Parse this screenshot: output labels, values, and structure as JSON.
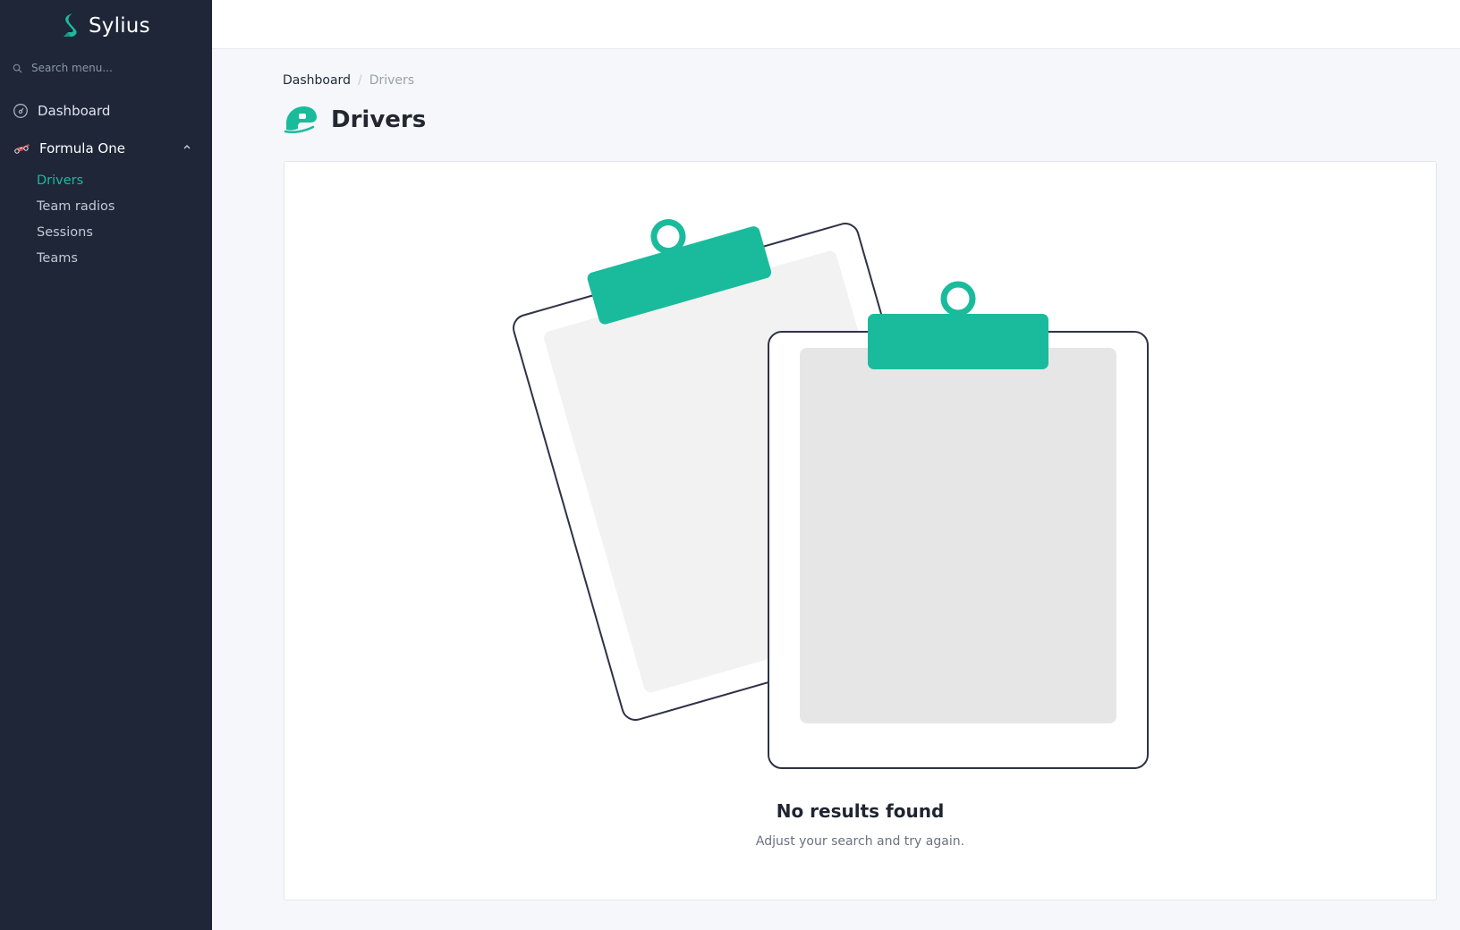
{
  "app": {
    "brand": "Sylius"
  },
  "sidebar": {
    "search_placeholder": "Search menu...",
    "dashboard_label": "Dashboard",
    "section_label": "Formula One",
    "items": [
      {
        "label": "Drivers",
        "active": true
      },
      {
        "label": "Team radios",
        "active": false
      },
      {
        "label": "Sessions",
        "active": false
      },
      {
        "label": "Teams",
        "active": false
      }
    ]
  },
  "breadcrumb": {
    "home": "Dashboard",
    "separator": "/",
    "current": "Drivers"
  },
  "page": {
    "title": "Drivers"
  },
  "empty_state": {
    "title": "No results found",
    "subtitle": "Adjust your search and try again."
  },
  "colors": {
    "accent": "#1abb9c",
    "sidebar_bg": "#1e2638",
    "page_bg": "#f5f7fa"
  },
  "icons": {
    "logo": "sylius-logo-icon",
    "search": "search-icon",
    "dashboard": "gauge-icon",
    "section": "race-car-icon",
    "chevron": "chevron-up-icon",
    "title": "helmet-icon"
  }
}
